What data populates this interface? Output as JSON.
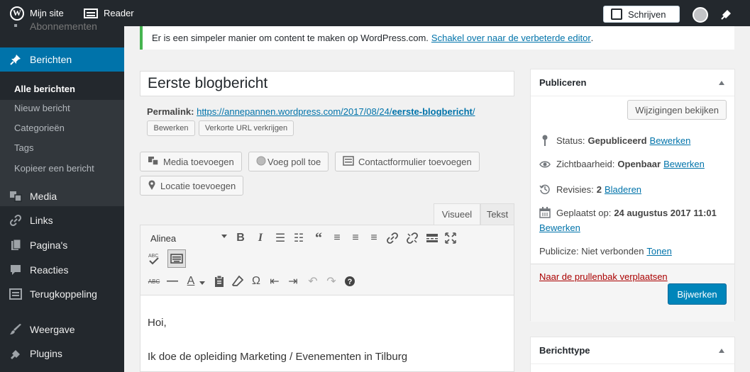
{
  "topbar": {
    "my_site": "Mijn site",
    "reader": "Reader",
    "write": "Schrijven"
  },
  "sidebar": {
    "cut_item": "Abonnementen",
    "berichten": "Berichten",
    "sub": [
      "Alle berichten",
      "Nieuw bericht",
      "Categorieën",
      "Tags",
      "Kopieer een bericht"
    ],
    "items": [
      "Media",
      "Links",
      "Pagina's",
      "Reacties",
      "Terugkoppeling",
      "Weergave",
      "Plugins"
    ]
  },
  "notice": {
    "text": "Er is een simpeler manier om content te maken op WordPress.com. ",
    "link": "Schakel over naar de verbeterde editor",
    "end": "."
  },
  "post": {
    "title": "Eerste blogbericht",
    "permalink_label": "Permalink: ",
    "permalink_base": "https://annepannen.wordpress.com/2017/08/24/",
    "permalink_slug": "eerste-blogbericht",
    "permalink_end": "/",
    "edit_btn": "Bewerken",
    "short_url_btn": "Verkorte URL verkrijgen"
  },
  "media_buttons": [
    "Media toevoegen",
    "Voeg poll toe",
    "Contactformulier toevoegen",
    "Locatie toevoegen"
  ],
  "editor": {
    "tab_visual": "Visueel",
    "tab_text": "Tekst",
    "format": "Alinea",
    "content": [
      "Hoi,",
      "Ik doe de opleiding Marketing / Evenementen in Tilburg"
    ]
  },
  "publish": {
    "title": "Publiceren",
    "preview": "Wijzigingen bekijken",
    "status_label": "Status: ",
    "status_value": "Gepubliceerd",
    "edit": "Bewerken",
    "visibility_label": "Zichtbaarheid: ",
    "visibility_value": "Openbaar",
    "revisions_label": "Revisies: ",
    "revisions_value": "2",
    "revisions_link": "Bladeren",
    "published_label": "Geplaatst op: ",
    "published_value": "24 augustus 2017 11:01",
    "publicize_label": "Publicize: Niet verbonden ",
    "publicize_link": "Tonen",
    "trash": "Naar de prullenbak verplaatsen",
    "update": "Bijwerken"
  },
  "post_type_box": {
    "title": "Berichttype"
  }
}
